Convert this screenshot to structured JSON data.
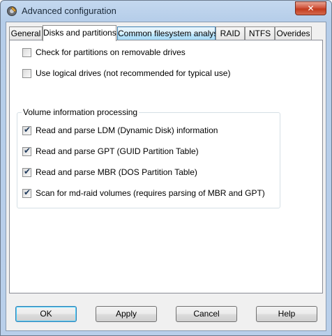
{
  "window": {
    "title": "Advanced configuration",
    "close_glyph": "✕"
  },
  "tabs": [
    {
      "label": "General"
    },
    {
      "label": "Disks and partitions"
    },
    {
      "label": "Common filesystem analysis"
    },
    {
      "label": "RAID"
    },
    {
      "label": "NTFS"
    },
    {
      "label": "Overides"
    }
  ],
  "selected_tab": "Disks and partitions",
  "options": {
    "removable": {
      "label": "Check for partitions on  removable drives",
      "checked": false
    },
    "logical": {
      "label": "Use logical drives (not recommended for typical use)",
      "checked": false
    }
  },
  "volume_group": {
    "title": "Volume information processing",
    "items": [
      {
        "label": "Read and parse LDM (Dynamic Disk) information",
        "checked": true
      },
      {
        "label": "Read and parse GPT (GUID Partition Table)",
        "checked": true
      },
      {
        "label": "Read and parse MBR (DOS Partition Table)",
        "checked": true
      },
      {
        "label": "Scan for md-raid volumes (requires parsing of MBR and GPT)",
        "checked": true
      }
    ]
  },
  "check_glyph": "✔",
  "buttons": {
    "ok": "OK",
    "apply": "Apply",
    "cancel": "Cancel",
    "help": "Help"
  },
  "colors": {
    "close_button": "#c23a1d",
    "tab_hover": "#bde6fd",
    "check_mark": "#1e395b"
  }
}
